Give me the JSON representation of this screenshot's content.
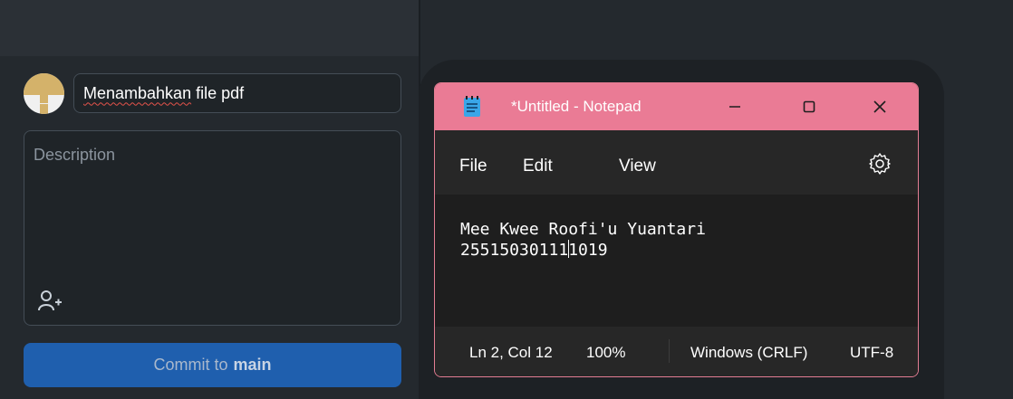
{
  "commit_panel": {
    "summary_value": "Menambahkan file pdf",
    "summary_misspelled": "Menambahkan",
    "summary_rest": " file pdf",
    "description_placeholder": "Description",
    "commit_button_prefix": "Commit to",
    "commit_button_branch": "main",
    "icons": {
      "avatar": "user-avatar",
      "coauthor": "add-coauthor-icon"
    }
  },
  "notepad": {
    "title": "*Untitled - Notepad",
    "menu": [
      "File",
      "Edit",
      "View"
    ],
    "icons": {
      "app": "notepad-icon",
      "settings": "gear-icon",
      "minimize": "minimize-icon",
      "maximize": "maximize-icon",
      "close": "close-icon"
    },
    "lines": [
      "Mee Kwee Roofi'u Yuantari",
      "25515030111",
      "1019"
    ],
    "status": {
      "position": "Ln 2, Col 12",
      "zoom": "100%",
      "line_ending": "Windows (CRLF)",
      "encoding": "UTF-8"
    }
  },
  "colors": {
    "notepad_titlebar": "#ea7b95",
    "commit_button": "#1f5fae",
    "panel_background": "#24292e"
  }
}
